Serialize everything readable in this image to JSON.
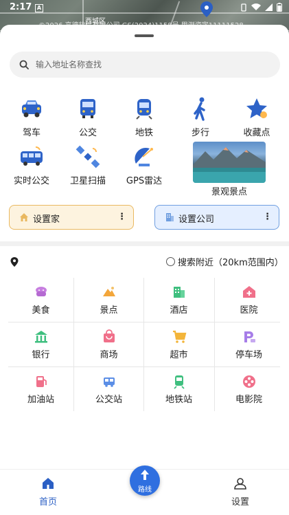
{
  "status_bar": {
    "time": "2:17",
    "badge": "A"
  },
  "map": {
    "copyright": "©2026 高德软件有限公司 GS(2024)1158号 甲测资字11111528",
    "place_label": "西城区"
  },
  "search": {
    "placeholder": "输入地址名称查找"
  },
  "features": [
    {
      "label": "驾车",
      "icon": "car-icon"
    },
    {
      "label": "公交",
      "icon": "bus-icon"
    },
    {
      "label": "地铁",
      "icon": "subway-icon"
    },
    {
      "label": "步行",
      "icon": "walking-icon"
    },
    {
      "label": "收藏点",
      "icon": "star-icon"
    },
    {
      "label": "实时公交",
      "icon": "realtime-bus-icon"
    },
    {
      "label": "卫星扫描",
      "icon": "satellite-icon"
    },
    {
      "label": "GPS雷达",
      "icon": "radar-icon"
    },
    {
      "label": "景观景点",
      "icon": "scenic-photo"
    }
  ],
  "shortcuts": {
    "home_label": "设置家",
    "work_label": "设置公司",
    "home_color": "#e9b860",
    "work_color": "#6f9ee0"
  },
  "nearby": {
    "label": "搜索附近（20km范围内）"
  },
  "categories": [
    {
      "label": "美食",
      "icon": "food-icon",
      "color": "#c77fe0"
    },
    {
      "label": "景点",
      "icon": "scenic-spot-icon",
      "color": "#f3a63a"
    },
    {
      "label": "酒店",
      "icon": "hotel-icon",
      "color": "#3fbf7f"
    },
    {
      "label": "医院",
      "icon": "hospital-icon",
      "color": "#f0708a"
    },
    {
      "label": "银行",
      "icon": "bank-icon",
      "color": "#3fbf7f"
    },
    {
      "label": "商场",
      "icon": "mall-icon",
      "color": "#f0708a"
    },
    {
      "label": "超市",
      "icon": "supermarket-icon",
      "color": "#f3b53a"
    },
    {
      "label": "停车场",
      "icon": "parking-icon",
      "color": "#a67de8"
    },
    {
      "label": "加油站",
      "icon": "gas-station-icon",
      "color": "#f0708a"
    },
    {
      "label": "公交站",
      "icon": "bus-stop-icon",
      "color": "#5b8ee6"
    },
    {
      "label": "地铁站",
      "icon": "metro-station-icon",
      "color": "#3fbf7f"
    },
    {
      "label": "电影院",
      "icon": "cinema-icon",
      "color": "#f0708a"
    }
  ],
  "tabbar": {
    "home_label": "首页",
    "route_label": "路线",
    "settings_label": "设置",
    "active_color": "#2b5fc4"
  }
}
